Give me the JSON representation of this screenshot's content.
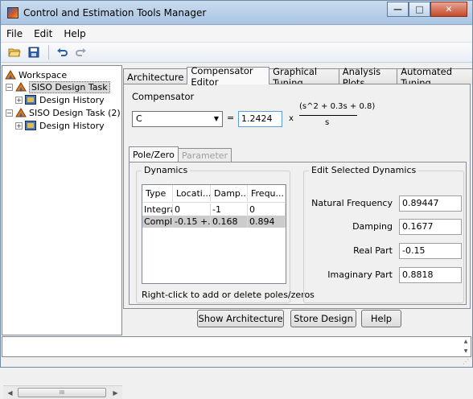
{
  "window": {
    "title": "Control and Estimation Tools Manager",
    "buttons": {
      "minimize": "—",
      "maximize": "□",
      "close": "✕"
    }
  },
  "menu": [
    "File",
    "Edit",
    "Help"
  ],
  "toolbar": {
    "icons": [
      "open-folder-icon",
      "save-icon",
      "undo-icon",
      "redo-icon"
    ]
  },
  "tree": {
    "root": "Workspace",
    "items": [
      {
        "label": "SISO Design Task",
        "selected": true
      },
      {
        "label": "Design History",
        "child": true
      },
      {
        "label": "SISO Design Task (2)",
        "selected": false
      },
      {
        "label": "Design History",
        "child": true
      }
    ],
    "scroll_thumb": "III"
  },
  "tabs": [
    {
      "label": "Architecture",
      "active": false
    },
    {
      "label": "Compensator Editor",
      "active": true
    },
    {
      "label": "Graphical Tuning",
      "active": false
    },
    {
      "label": "Analysis Plots",
      "active": false
    },
    {
      "label": "Automated Tuning",
      "active": false
    }
  ],
  "compensator": {
    "label": "Compensator",
    "selected": "C",
    "equals": "=",
    "gain": "1.2424",
    "times": "x",
    "numerator": "(s^2 + 0.3s + 0.8)",
    "denominator": "s"
  },
  "subtabs": [
    {
      "label": "Pole/Zero",
      "enabled": true
    },
    {
      "label": "Parameter",
      "enabled": false
    }
  ],
  "dynamics": {
    "title": "Dynamics",
    "columns": [
      "Type",
      "Locati...",
      "Damp...",
      "Frequ..."
    ],
    "rows": [
      [
        "Integra...",
        "0",
        "-1",
        "0"
      ],
      [
        "Compl...",
        "-0.15 +...",
        "0.168",
        "0.894"
      ]
    ],
    "hint": "Right-click to add or delete poles/zeros"
  },
  "edit": {
    "title": "Edit Selected Dynamics",
    "fields": [
      {
        "label": "Natural Frequency",
        "value": "0.89447"
      },
      {
        "label": "Damping",
        "value": "0.1677"
      },
      {
        "label": "Real Part",
        "value": "-0.15"
      },
      {
        "label": "Imaginary Part",
        "value": "0.8818"
      }
    ]
  },
  "buttons": {
    "show_architecture": "Show Architecture",
    "store_design": "Store Design",
    "help": "Help"
  }
}
